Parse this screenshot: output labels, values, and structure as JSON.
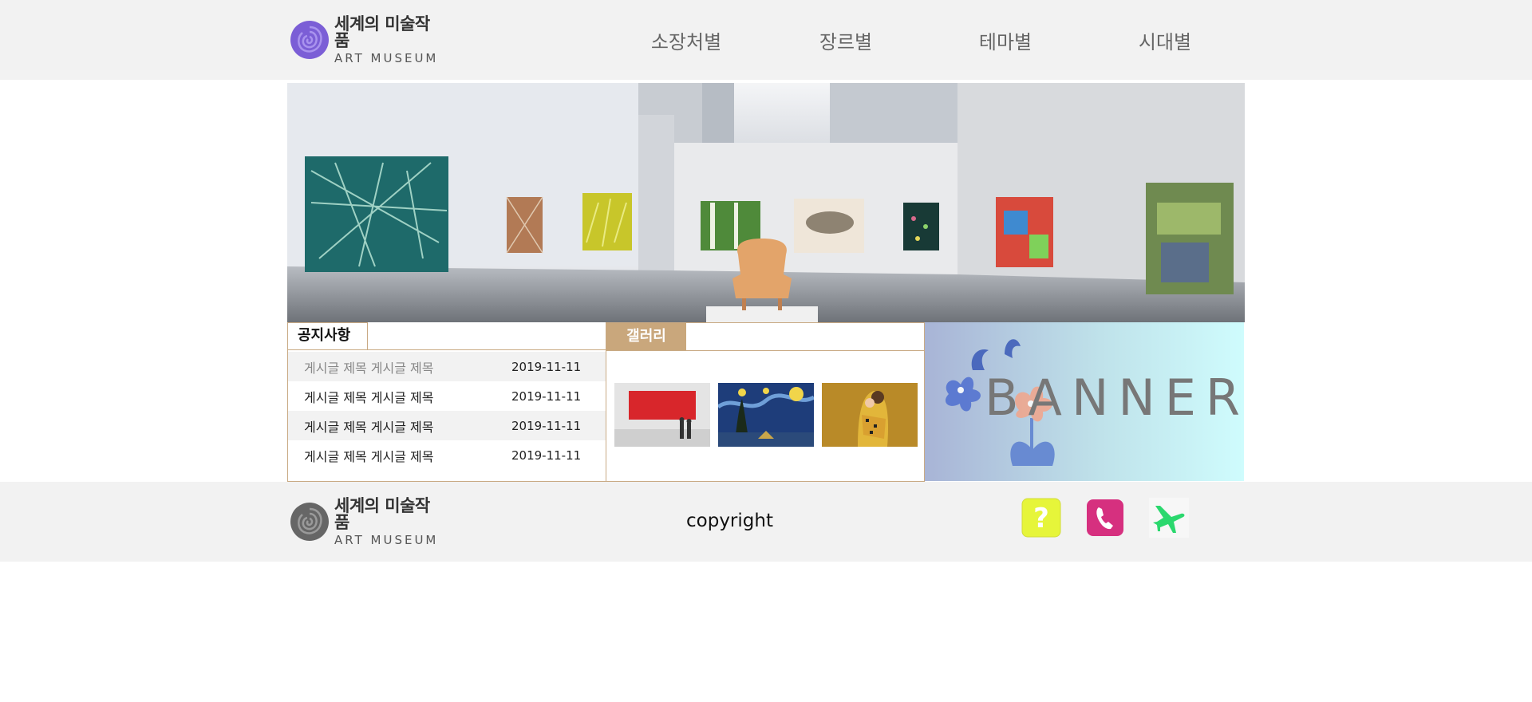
{
  "header": {
    "logo": {
      "title_ko": "세계의 미술작품",
      "title_en": "ART MUSEUM"
    },
    "nav": [
      "소장처별",
      "장르별",
      "테마별",
      "시대별"
    ]
  },
  "notice": {
    "tab_label": "공지사항",
    "items": [
      {
        "title": "게시글 제목 게시글 제목",
        "date": "2019-11-11"
      },
      {
        "title": "게시글 제목 게시글 제목",
        "date": "2019-11-11"
      },
      {
        "title": "게시글 제목 게시글 제목",
        "date": "2019-11-11"
      },
      {
        "title": "게시글 제목 게시글 제목",
        "date": "2019-11-11"
      }
    ]
  },
  "gallery": {
    "tab_label": "갤러리",
    "thumbs": [
      "red-painting",
      "starry-night",
      "the-kiss"
    ]
  },
  "banner": {
    "text": "BANNER"
  },
  "footer": {
    "logo": {
      "title_ko": "세계의 미술작품",
      "title_en": "ART MUSEUM"
    },
    "copyright": "copyright",
    "icons": [
      "question-icon",
      "phone-icon",
      "airplane-icon"
    ]
  },
  "colors": {
    "accent": "#c9a77c",
    "header_bg": "#f2f2f2",
    "question": "#e6f53a",
    "phone": "#d6307f",
    "airplane": "#2bd86e"
  }
}
